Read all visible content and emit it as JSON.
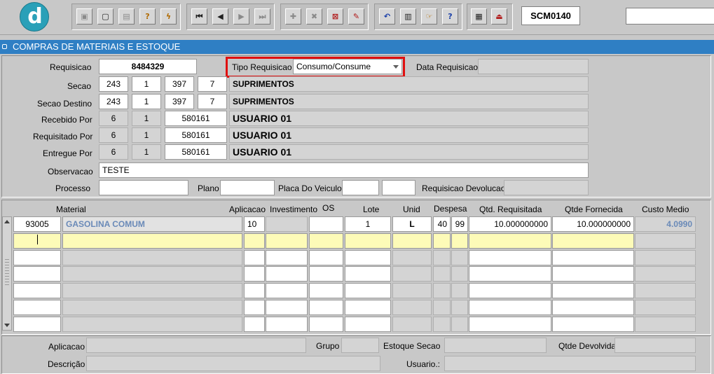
{
  "toolbar": {
    "logo_letter": "d",
    "form_code": "SCM0140",
    "buttons": [
      {
        "glyph": "▣"
      },
      {
        "glyph": "▢"
      },
      {
        "glyph": "▤"
      },
      {
        "glyph": "?"
      },
      {
        "glyph": "ϟ"
      },
      {
        "glyph": "⏮"
      },
      {
        "glyph": "◀"
      },
      {
        "glyph": "▶"
      },
      {
        "glyph": "⏭"
      },
      {
        "glyph": "✚"
      },
      {
        "glyph": "✖"
      },
      {
        "glyph": "⊠"
      },
      {
        "glyph": "✎"
      },
      {
        "glyph": "↶"
      },
      {
        "glyph": "▥"
      },
      {
        "glyph": "☞"
      },
      {
        "glyph": "?"
      },
      {
        "glyph": "▦"
      },
      {
        "glyph": "⏏"
      }
    ]
  },
  "title": "COMPRAS DE MATERIAIS E ESTOQUE",
  "header": {
    "requisicao_label": "Requisicao",
    "requisicao": "8484329",
    "tipo_label": "Tipo Requisicao",
    "tipo_value": "Consumo/Consume",
    "data_label": "Data Requisicao",
    "data_value": "",
    "secao_label": "Secao",
    "secao": [
      "243",
      "1",
      "397",
      "7"
    ],
    "secao_name": "SUPRIMENTOS",
    "secao_dest_label": "Secao Destino",
    "secao_dest": [
      "243",
      "1",
      "397",
      "7"
    ],
    "secao_dest_name": "SUPRIMENTOS",
    "recebido_label": "Recebido Por",
    "recebido": [
      "6",
      "1",
      "580161"
    ],
    "recebido_name": "USUARIO 01",
    "requisitado_label": "Requisitado Por",
    "requisitado": [
      "6",
      "1",
      "580161"
    ],
    "requisitado_name": "USUARIO 01",
    "entregue_label": "Entregue Por",
    "entregue": [
      "6",
      "1",
      "580161"
    ],
    "entregue_name": "USUARIO 01",
    "obs_label": "Observacao",
    "obs": "TESTE",
    "processo_label": "Processo",
    "plano_label": "Plano",
    "placa_label": "Placa Do Veiculo",
    "req_dev_label": "Requisicao Devolucao"
  },
  "grid": {
    "columns": [
      "Material",
      "Aplicacao",
      "Investimento",
      "OS",
      "Lote",
      "Unid",
      "Despesa",
      "Qtd. Requisitada",
      "Qtde Fornecida",
      "Custo Medio"
    ],
    "rows": [
      {
        "cod": "93005",
        "material": "GASOLINA COMUM",
        "aplicacao": "10",
        "investimento": "",
        "os": "",
        "lote": "1",
        "unid": "L",
        "desp1": "40",
        "desp2": "99",
        "qtd_req": "10.000000000",
        "qtd_forn": "10.000000000",
        "custo": "4.0990"
      }
    ]
  },
  "footer": {
    "aplicacao_label": "Aplicacao",
    "grupo_label": "Grupo",
    "estoque_label": "Estoque Secao",
    "qtde_dev_label": "Qtde Devolvida",
    "descricao_label": "Descrição",
    "usuario_label": "Usuario.:"
  },
  "colors": {
    "title_bar": "#2f7fc4",
    "highlight_row": "#fdfbb8",
    "material_text": "#6a8ab8",
    "accent_red": "#e01010"
  }
}
